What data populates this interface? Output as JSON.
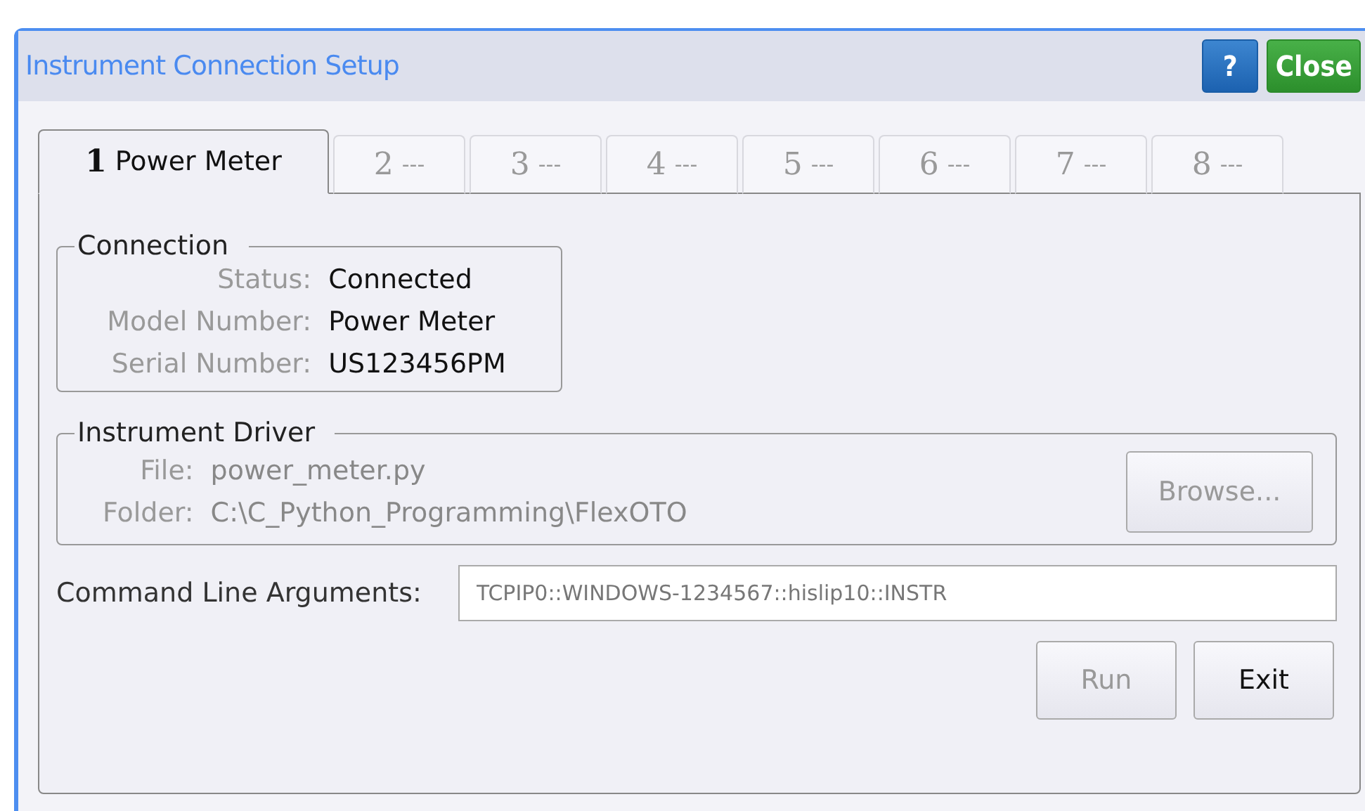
{
  "window": {
    "title": "Instrument Connection Setup"
  },
  "header_buttons": [
    {
      "kind": "help",
      "label": "?"
    },
    {
      "kind": "close",
      "label": "Close"
    }
  ],
  "tabs": [
    {
      "number": "1",
      "label": "Power Meter",
      "selected": true
    },
    {
      "number": "2",
      "label": "---",
      "selected": false
    },
    {
      "number": "3",
      "label": "---",
      "selected": false
    },
    {
      "number": "4",
      "label": "---",
      "selected": false
    },
    {
      "number": "5",
      "label": "---",
      "selected": false
    },
    {
      "number": "6",
      "label": "---",
      "selected": false
    },
    {
      "number": "7",
      "label": "---",
      "selected": false
    },
    {
      "number": "8",
      "label": "---",
      "selected": false
    }
  ],
  "connection": {
    "title": "Connection",
    "fields": [
      {
        "label": "Status:",
        "value": "Connected"
      },
      {
        "label": "Model Number:",
        "value": "Power Meter"
      },
      {
        "label": "Serial Number:",
        "value": "US123456PM"
      }
    ]
  },
  "instrument_driver": {
    "title": "Instrument Driver",
    "fields": [
      {
        "label": "File:",
        "value": "power_meter.py"
      },
      {
        "label": "Folder:",
        "value": "C:\\C_Python_Programming\\FlexOTO"
      }
    ],
    "browse_button": {
      "label": "Browse...",
      "disabled": true
    }
  },
  "command_line": {
    "label": "Command Line Arguments:",
    "value": "TCPIP0::WINDOWS-1234567::hislip10::INSTR"
  },
  "buttons": [
    {
      "label": "Run",
      "disabled": true
    },
    {
      "label": "Exit",
      "disabled": false
    }
  ]
}
